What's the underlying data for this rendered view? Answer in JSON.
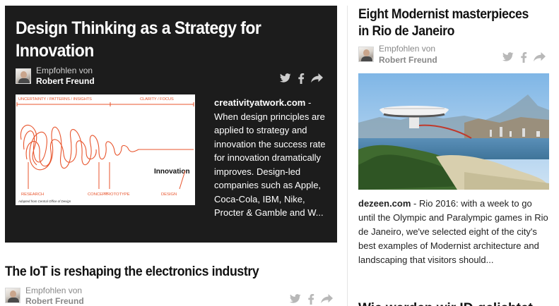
{
  "cards": {
    "featured": {
      "title": "Design Thinking as a Strategy for Innovation",
      "recommended_label": "Empfohlen von",
      "author": "Robert Freund",
      "source": "creativityatwork.com",
      "description": " - When design principles are applied to strategy and innovation the success rate for innovation dramatically improves. Design-led companies such as Apple, Coca-Cola, IBM, Nike, Procter & Gamble and W...",
      "thumbnail": {
        "top_left": "UNCERTAINTY / PATTERNS / INSIGHTS",
        "top_right": "CLARITY / FOCUS",
        "center": "Innovation",
        "bottom_labels": [
          "RESEARCH",
          "CONCEPT",
          "PROTOTYPE",
          "DESIGN"
        ],
        "credit": "Adapted from Central Office of Design"
      }
    },
    "second": {
      "title": "The IoT is reshaping the electronics industry",
      "recommended_label": "Empfohlen von",
      "author": "Robert Freund"
    },
    "right": {
      "title": "Eight Modernist masterpieces in Rio de Janeiro",
      "recommended_label": "Empfohlen von",
      "author": "Robert Freund",
      "source": "dezeen.com",
      "description": " - Rio 2016: with a week to go until the Olympic and Paralympic games in Rio de Janeiro, we've selected eight of the city's best examples of Modernist architecture and landscaping that visitors should...",
      "next_title_peek": "Wie werden wir ID-gelichtet..."
    }
  },
  "icons": {
    "share": [
      "twitter-icon",
      "facebook-icon",
      "share-arrow-icon"
    ]
  },
  "colors": {
    "dark_card_bg": "#1c1c1c",
    "icon_dark_card": "#cccccc",
    "icon_light": "#b8b8b8",
    "meta_gray": "#888888",
    "sketch_orange": "#e8542c"
  }
}
